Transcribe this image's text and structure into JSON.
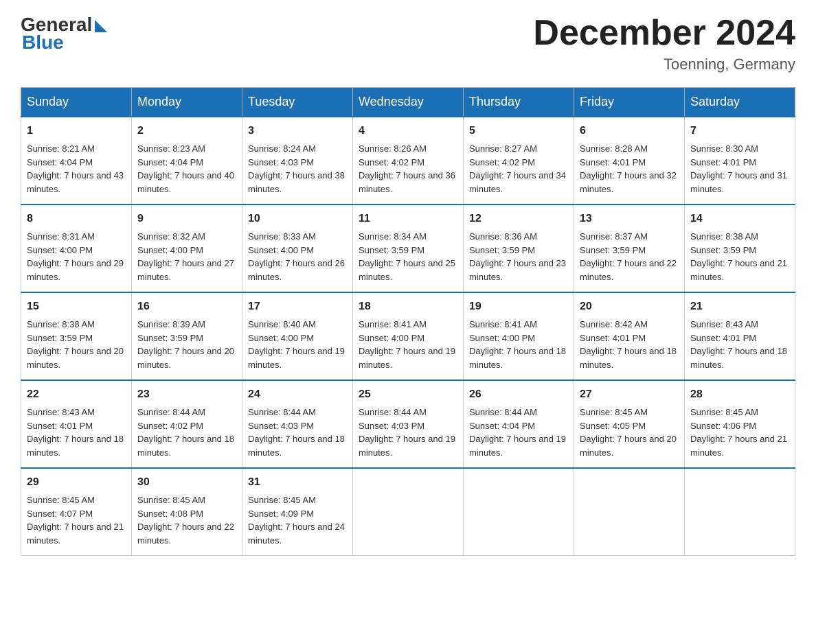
{
  "header": {
    "logo_general": "General",
    "logo_blue": "Blue",
    "month_title": "December 2024",
    "location": "Toenning, Germany"
  },
  "weekdays": [
    "Sunday",
    "Monday",
    "Tuesday",
    "Wednesday",
    "Thursday",
    "Friday",
    "Saturday"
  ],
  "weeks": [
    [
      {
        "day": "1",
        "sunrise": "8:21 AM",
        "sunset": "4:04 PM",
        "daylight": "7 hours and 43 minutes."
      },
      {
        "day": "2",
        "sunrise": "8:23 AM",
        "sunset": "4:04 PM",
        "daylight": "7 hours and 40 minutes."
      },
      {
        "day": "3",
        "sunrise": "8:24 AM",
        "sunset": "4:03 PM",
        "daylight": "7 hours and 38 minutes."
      },
      {
        "day": "4",
        "sunrise": "8:26 AM",
        "sunset": "4:02 PM",
        "daylight": "7 hours and 36 minutes."
      },
      {
        "day": "5",
        "sunrise": "8:27 AM",
        "sunset": "4:02 PM",
        "daylight": "7 hours and 34 minutes."
      },
      {
        "day": "6",
        "sunrise": "8:28 AM",
        "sunset": "4:01 PM",
        "daylight": "7 hours and 32 minutes."
      },
      {
        "day": "7",
        "sunrise": "8:30 AM",
        "sunset": "4:01 PM",
        "daylight": "7 hours and 31 minutes."
      }
    ],
    [
      {
        "day": "8",
        "sunrise": "8:31 AM",
        "sunset": "4:00 PM",
        "daylight": "7 hours and 29 minutes."
      },
      {
        "day": "9",
        "sunrise": "8:32 AM",
        "sunset": "4:00 PM",
        "daylight": "7 hours and 27 minutes."
      },
      {
        "day": "10",
        "sunrise": "8:33 AM",
        "sunset": "4:00 PM",
        "daylight": "7 hours and 26 minutes."
      },
      {
        "day": "11",
        "sunrise": "8:34 AM",
        "sunset": "3:59 PM",
        "daylight": "7 hours and 25 minutes."
      },
      {
        "day": "12",
        "sunrise": "8:36 AM",
        "sunset": "3:59 PM",
        "daylight": "7 hours and 23 minutes."
      },
      {
        "day": "13",
        "sunrise": "8:37 AM",
        "sunset": "3:59 PM",
        "daylight": "7 hours and 22 minutes."
      },
      {
        "day": "14",
        "sunrise": "8:38 AM",
        "sunset": "3:59 PM",
        "daylight": "7 hours and 21 minutes."
      }
    ],
    [
      {
        "day": "15",
        "sunrise": "8:38 AM",
        "sunset": "3:59 PM",
        "daylight": "7 hours and 20 minutes."
      },
      {
        "day": "16",
        "sunrise": "8:39 AM",
        "sunset": "3:59 PM",
        "daylight": "7 hours and 20 minutes."
      },
      {
        "day": "17",
        "sunrise": "8:40 AM",
        "sunset": "4:00 PM",
        "daylight": "7 hours and 19 minutes."
      },
      {
        "day": "18",
        "sunrise": "8:41 AM",
        "sunset": "4:00 PM",
        "daylight": "7 hours and 19 minutes."
      },
      {
        "day": "19",
        "sunrise": "8:41 AM",
        "sunset": "4:00 PM",
        "daylight": "7 hours and 18 minutes."
      },
      {
        "day": "20",
        "sunrise": "8:42 AM",
        "sunset": "4:01 PM",
        "daylight": "7 hours and 18 minutes."
      },
      {
        "day": "21",
        "sunrise": "8:43 AM",
        "sunset": "4:01 PM",
        "daylight": "7 hours and 18 minutes."
      }
    ],
    [
      {
        "day": "22",
        "sunrise": "8:43 AM",
        "sunset": "4:01 PM",
        "daylight": "7 hours and 18 minutes."
      },
      {
        "day": "23",
        "sunrise": "8:44 AM",
        "sunset": "4:02 PM",
        "daylight": "7 hours and 18 minutes."
      },
      {
        "day": "24",
        "sunrise": "8:44 AM",
        "sunset": "4:03 PM",
        "daylight": "7 hours and 18 minutes."
      },
      {
        "day": "25",
        "sunrise": "8:44 AM",
        "sunset": "4:03 PM",
        "daylight": "7 hours and 19 minutes."
      },
      {
        "day": "26",
        "sunrise": "8:44 AM",
        "sunset": "4:04 PM",
        "daylight": "7 hours and 19 minutes."
      },
      {
        "day": "27",
        "sunrise": "8:45 AM",
        "sunset": "4:05 PM",
        "daylight": "7 hours and 20 minutes."
      },
      {
        "day": "28",
        "sunrise": "8:45 AM",
        "sunset": "4:06 PM",
        "daylight": "7 hours and 21 minutes."
      }
    ],
    [
      {
        "day": "29",
        "sunrise": "8:45 AM",
        "sunset": "4:07 PM",
        "daylight": "7 hours and 21 minutes."
      },
      {
        "day": "30",
        "sunrise": "8:45 AM",
        "sunset": "4:08 PM",
        "daylight": "7 hours and 22 minutes."
      },
      {
        "day": "31",
        "sunrise": "8:45 AM",
        "sunset": "4:09 PM",
        "daylight": "7 hours and 24 minutes."
      },
      null,
      null,
      null,
      null
    ]
  ]
}
